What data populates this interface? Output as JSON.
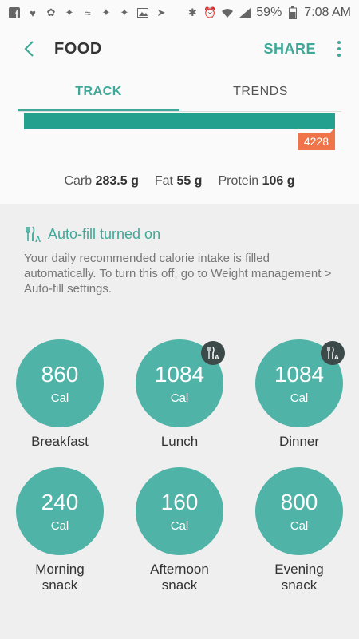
{
  "status_bar": {
    "icons_left": [
      "facebook-icon",
      "bag-icon",
      "bird-icon",
      "twitter-icon",
      "wave-icon",
      "twitter-icon",
      "twitter-icon",
      "image-icon",
      "send-icon"
    ],
    "battery": "59%",
    "time": "7:08 AM"
  },
  "app_bar": {
    "title": "FOOD",
    "share": "SHARE"
  },
  "tabs": [
    {
      "label": "TRACK",
      "active": true
    },
    {
      "label": "TRENDS",
      "active": false
    }
  ],
  "summary": {
    "bar_fill_fraction": 1.0,
    "over_value": "4228",
    "macros": [
      {
        "label": "Carb",
        "value": "283.5 g"
      },
      {
        "label": "Fat",
        "value": "55 g"
      },
      {
        "label": "Protein",
        "value": "106 g"
      }
    ]
  },
  "autofill": {
    "title": "Auto-fill turned on",
    "description": "Your daily recommended calorie intake is filled automatically. To turn this off, go to Weight management > Auto-fill settings."
  },
  "meals": [
    {
      "value": "860",
      "unit": "Cal",
      "label": "Breakfast",
      "autofill": false
    },
    {
      "value": "1084",
      "unit": "Cal",
      "label": "Lunch",
      "autofill": true
    },
    {
      "value": "1084",
      "unit": "Cal",
      "label": "Dinner",
      "autofill": true
    },
    {
      "value": "240",
      "unit": "Cal",
      "label": "Morning\nsnack",
      "autofill": false
    },
    {
      "value": "160",
      "unit": "Cal",
      "label": "Afternoon\nsnack",
      "autofill": false
    },
    {
      "value": "800",
      "unit": "Cal",
      "label": "Evening\nsnack",
      "autofill": false
    }
  ],
  "colors": {
    "accent": "#3fa898",
    "bar": "#24a08f",
    "over": "#f07449",
    "circle": "#4fb3a7"
  }
}
